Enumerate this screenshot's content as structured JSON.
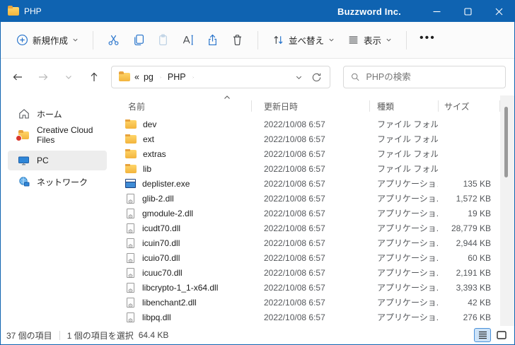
{
  "window": {
    "title": "PHP",
    "owner": "Buzzword Inc."
  },
  "toolbar": {
    "new_label": "新規作成",
    "sort_label": "並べ替え",
    "view_label": "表示"
  },
  "addressbar": {
    "overflow": "«",
    "segments": [
      "pg",
      "PHP"
    ]
  },
  "search": {
    "placeholder": "PHPの検索"
  },
  "sidebar": {
    "items": [
      {
        "label": "ホーム"
      },
      {
        "label": "Creative Cloud Files"
      },
      {
        "label": "PC",
        "selected": true
      },
      {
        "label": "ネットワーク"
      }
    ]
  },
  "files": {
    "columns": [
      "名前",
      "更新日時",
      "種類",
      "サイズ"
    ],
    "rows": [
      {
        "name": "dev",
        "date": "2022/10/08 6:57",
        "type": "ファイル フォル...",
        "size": "",
        "icon": "folder"
      },
      {
        "name": "ext",
        "date": "2022/10/08 6:57",
        "type": "ファイル フォル...",
        "size": "",
        "icon": "folder"
      },
      {
        "name": "extras",
        "date": "2022/10/08 6:57",
        "type": "ファイル フォル...",
        "size": "",
        "icon": "folder"
      },
      {
        "name": "lib",
        "date": "2022/10/08 6:57",
        "type": "ファイル フォル...",
        "size": "",
        "icon": "folder"
      },
      {
        "name": "deplister.exe",
        "date": "2022/10/08 6:57",
        "type": "アプリケーション",
        "size": "135 KB",
        "icon": "exe"
      },
      {
        "name": "glib-2.dll",
        "date": "2022/10/08 6:57",
        "type": "アプリケーショ...",
        "size": "1,572 KB",
        "icon": "dll"
      },
      {
        "name": "gmodule-2.dll",
        "date": "2022/10/08 6:57",
        "type": "アプリケーショ...",
        "size": "19 KB",
        "icon": "dll"
      },
      {
        "name": "icudt70.dll",
        "date": "2022/10/08 6:57",
        "type": "アプリケーショ...",
        "size": "28,779 KB",
        "icon": "dll"
      },
      {
        "name": "icuin70.dll",
        "date": "2022/10/08 6:57",
        "type": "アプリケーショ...",
        "size": "2,944 KB",
        "icon": "dll"
      },
      {
        "name": "icuio70.dll",
        "date": "2022/10/08 6:57",
        "type": "アプリケーショ...",
        "size": "60 KB",
        "icon": "dll"
      },
      {
        "name": "icuuc70.dll",
        "date": "2022/10/08 6:57",
        "type": "アプリケーショ...",
        "size": "2,191 KB",
        "icon": "dll"
      },
      {
        "name": "libcrypto-1_1-x64.dll",
        "date": "2022/10/08 6:57",
        "type": "アプリケーショ...",
        "size": "3,393 KB",
        "icon": "dll"
      },
      {
        "name": "libenchant2.dll",
        "date": "2022/10/08 6:57",
        "type": "アプリケーショ...",
        "size": "42 KB",
        "icon": "dll"
      },
      {
        "name": "libpq.dll",
        "date": "2022/10/08 6:57",
        "type": "アプリケーショ...",
        "size": "276 KB",
        "icon": "dll"
      }
    ]
  },
  "statusbar": {
    "item_count": "37 個の項目",
    "selection": "1 個の項目を選択",
    "selection_size": "64.4 KB"
  },
  "colors": {
    "titlebar_blue": "#0f63b1",
    "accent_blue": "#2572cb",
    "folder_yellow": "#f3b43c",
    "disabled_blue": "#b9cfe3"
  }
}
